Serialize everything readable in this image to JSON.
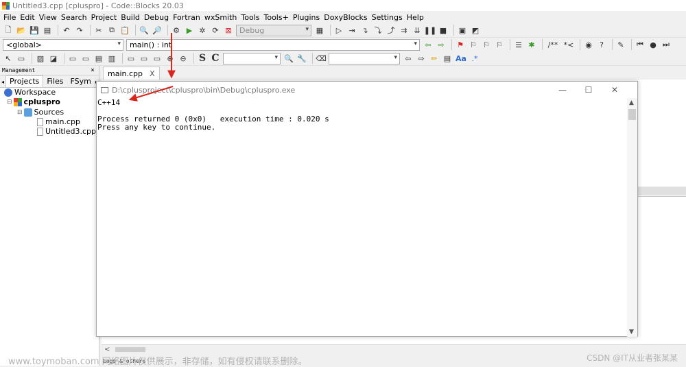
{
  "window": {
    "title": "Untitled3.cpp [cpluspro] - Code::Blocks 20.03"
  },
  "menu": [
    "File",
    "Edit",
    "View",
    "Search",
    "Project",
    "Build",
    "Debug",
    "Fortran",
    "wxSmith",
    "Tools",
    "Tools+",
    "Plugins",
    "DoxyBlocks",
    "Settings",
    "Help"
  ],
  "toolbar": {
    "build_target": "Debug",
    "scope_combo": "<global>",
    "symbol_combo": "main() : int",
    "bold_s": "S",
    "bold_c": "C",
    "regex_btn": "Aa",
    "regex_star": ".*"
  },
  "management": {
    "title": "Management",
    "close": "×",
    "tabs": [
      "Projects",
      "Files",
      "FSym"
    ],
    "tab_arrow": "▸",
    "tree": {
      "workspace": "Workspace",
      "project": "cpluspro",
      "sources": "Sources",
      "files": [
        "main.cpp",
        "Untitled3.cpp"
      ]
    }
  },
  "editor": {
    "tab_label": "main.cpp",
    "tab_close": "X"
  },
  "console": {
    "title": "D:\\cplusproject\\cpluspro\\bin\\Debug\\cpluspro.exe",
    "output": "C++14\n\nProcess returned 0 (0x0)   execution time : 0.020 s\nPress any key to continue.",
    "controls": {
      "minimize": "—",
      "maximize": "☐",
      "close": "✕"
    }
  },
  "logs_label": "Logs & others",
  "watermark": {
    "left": "www.toymoban.com 网络图片仅供展示，非存储，如有侵权请联系删除。",
    "right": "CSDN @IT从业者张某某"
  },
  "colors": {
    "annotation_arrow": "#d9261c",
    "console_bg": "#ffffff"
  }
}
